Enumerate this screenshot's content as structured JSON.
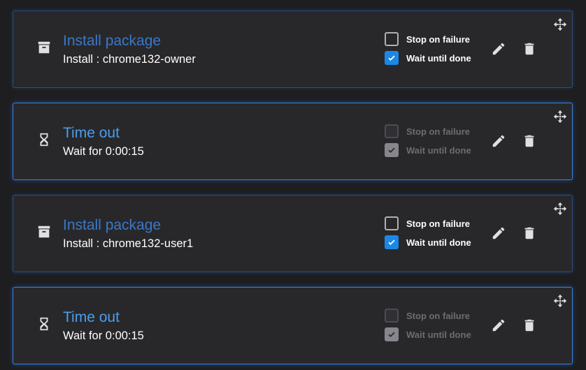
{
  "colors": {
    "background": "#1e1e20",
    "card": "#28282b",
    "package_title": "#3a78c8",
    "timeout_title": "#4a9ef0",
    "checkbox_checked": "#1b88e8"
  },
  "steps": [
    {
      "type": "package",
      "icon": "archive-icon",
      "title": "Install package",
      "subtitle": "Install : chrome132-owner",
      "stop_on_failure": {
        "label": "Stop on failure",
        "checked": false,
        "disabled": false
      },
      "wait_until_done": {
        "label": "Wait until done",
        "checked": true,
        "disabled": false
      }
    },
    {
      "type": "timeout",
      "icon": "hourglass-icon",
      "title": "Time out",
      "subtitle": "Wait for 0:00:15",
      "stop_on_failure": {
        "label": "Stop on failure",
        "checked": false,
        "disabled": true
      },
      "wait_until_done": {
        "label": "Wait until done",
        "checked": true,
        "disabled": true
      }
    },
    {
      "type": "package",
      "icon": "archive-icon",
      "title": "Install package",
      "subtitle": "Install : chrome132-user1",
      "stop_on_failure": {
        "label": "Stop on failure",
        "checked": false,
        "disabled": false
      },
      "wait_until_done": {
        "label": "Wait until done",
        "checked": true,
        "disabled": false
      }
    },
    {
      "type": "timeout",
      "icon": "hourglass-icon",
      "title": "Time out",
      "subtitle": "Wait for 0:00:15",
      "stop_on_failure": {
        "label": "Stop on failure",
        "checked": false,
        "disabled": true
      },
      "wait_until_done": {
        "label": "Wait until done",
        "checked": true,
        "disabled": true
      }
    }
  ]
}
